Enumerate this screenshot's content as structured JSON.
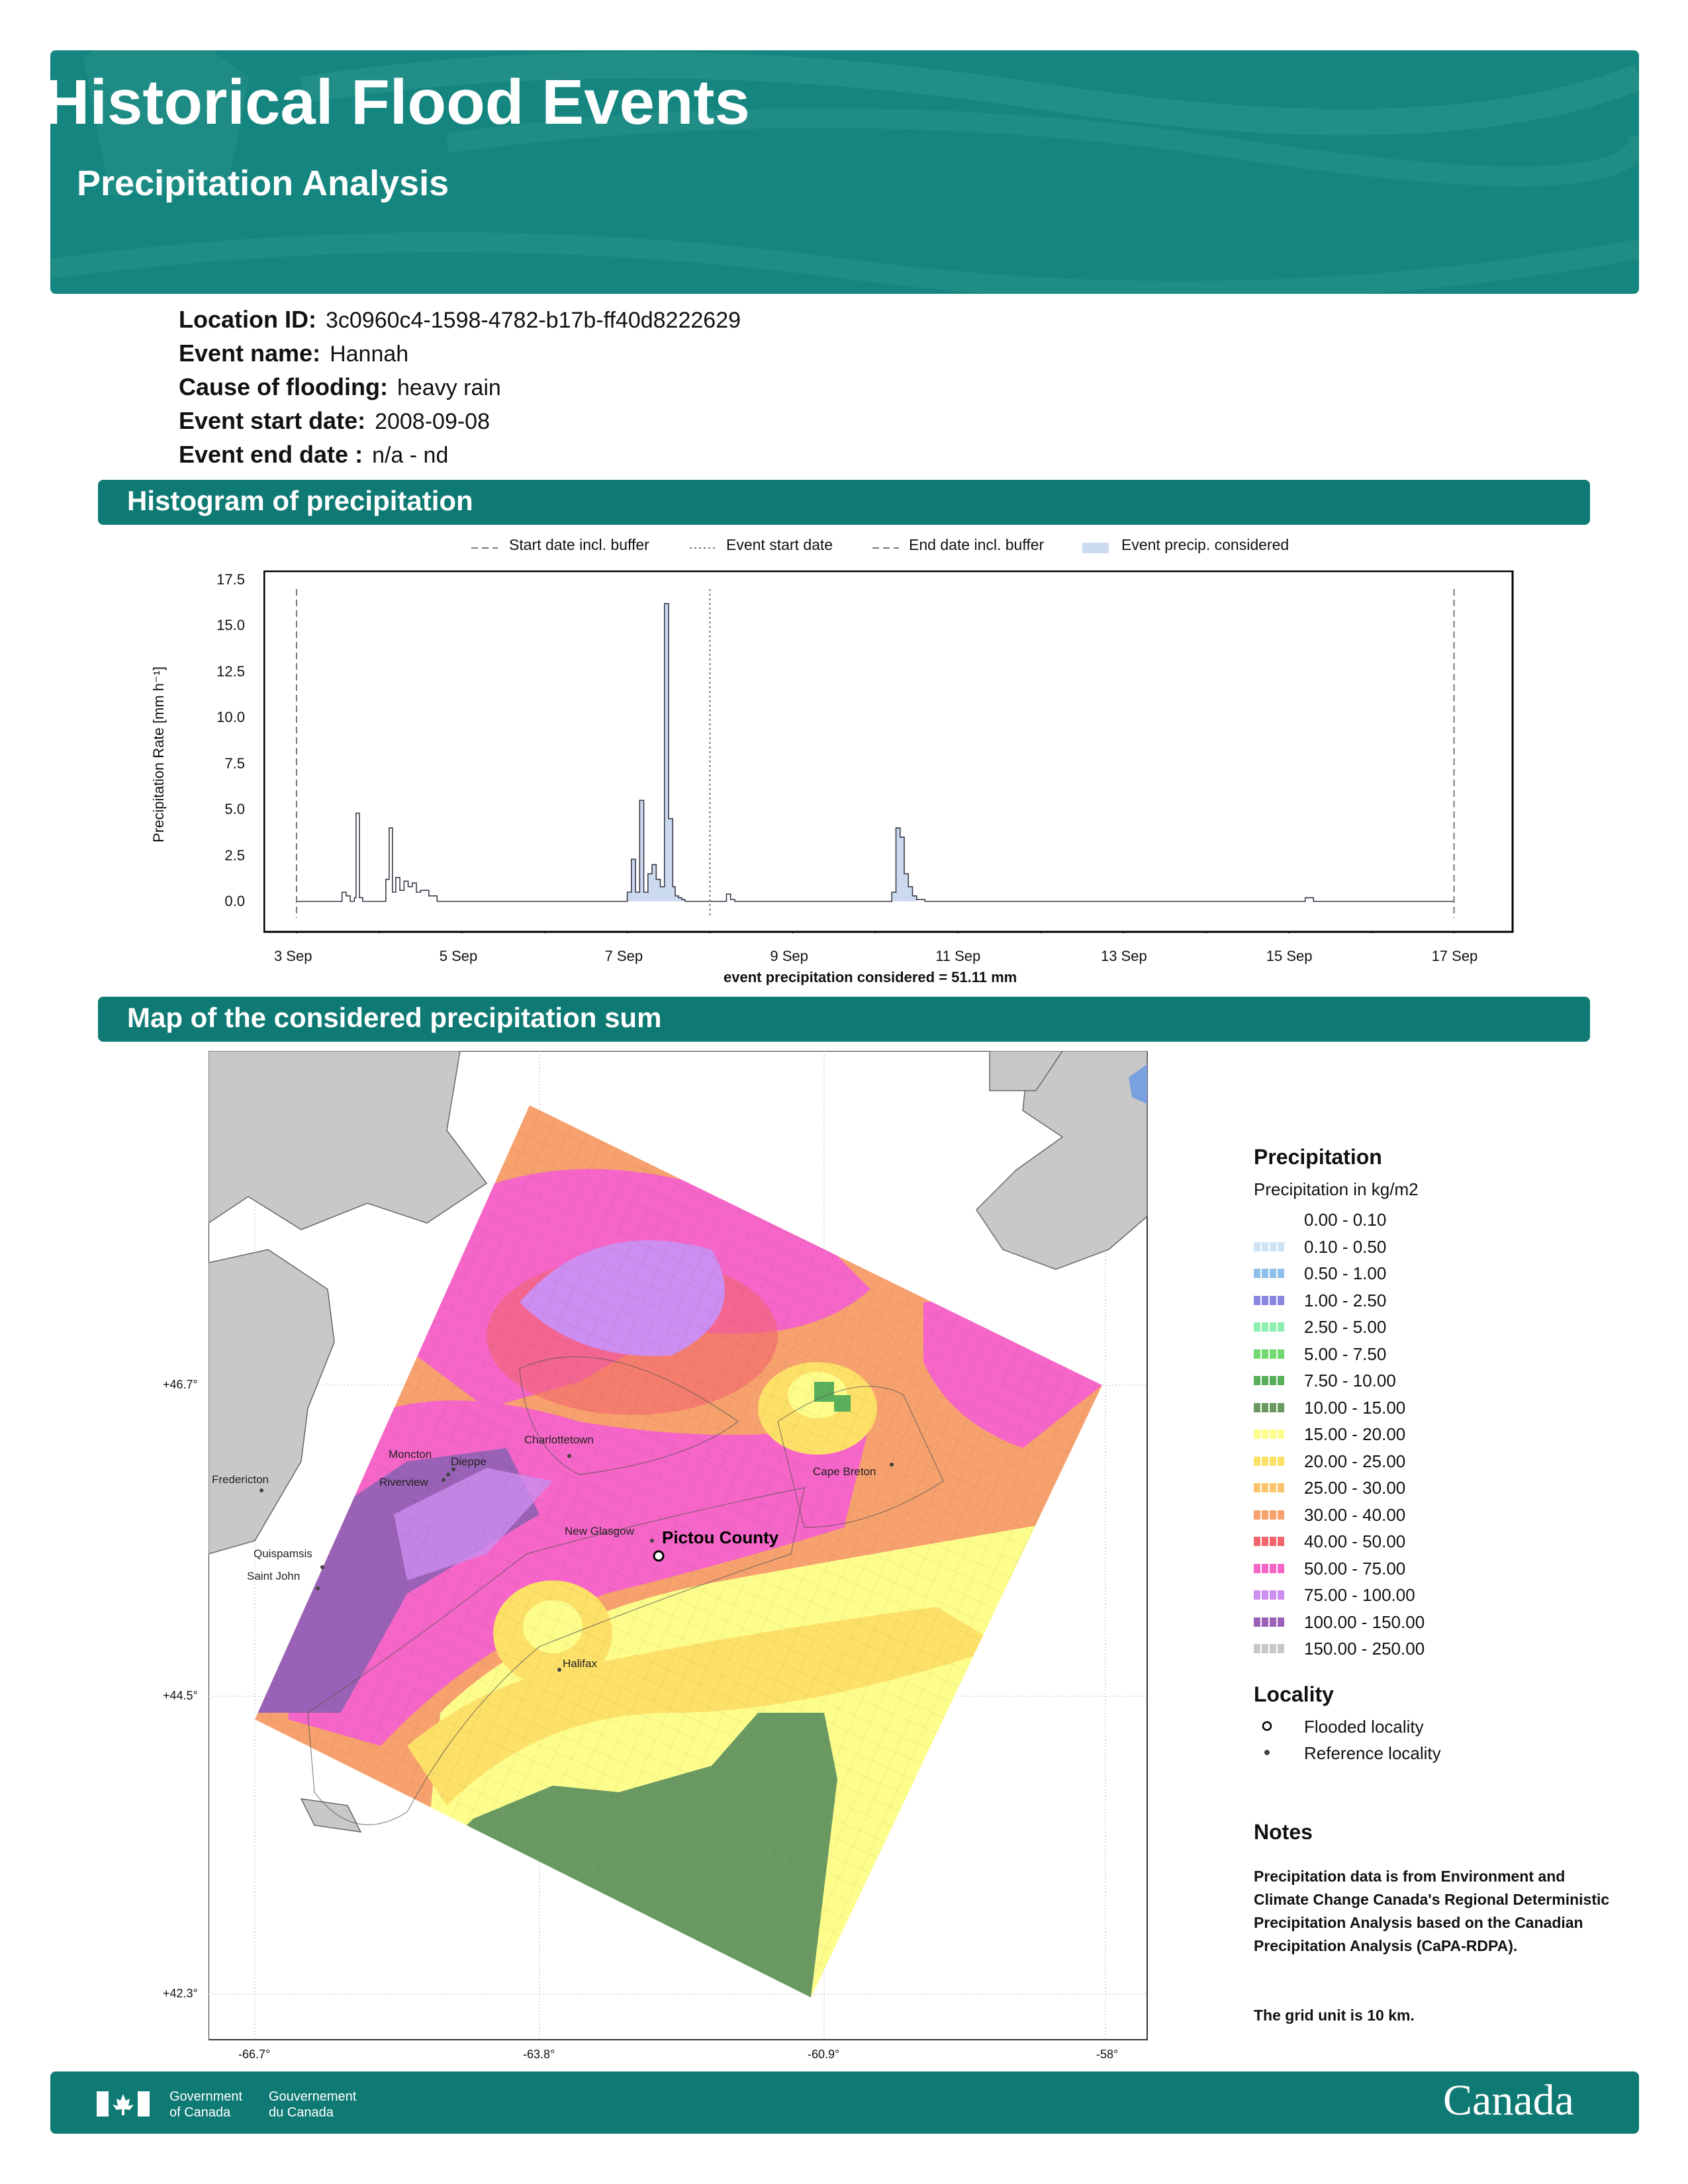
{
  "header": {
    "title": "Historical Flood Events",
    "subtitle": "Precipitation Analysis",
    "colors": {
      "banner": "#15857f",
      "section": "#0f7a74"
    }
  },
  "info": {
    "location_id_label": "Location ID:",
    "location_id": "3c0960c4-1598-4782-b17b-ff40d8222629",
    "event_name_label": "Event name:",
    "event_name": "Hannah",
    "cause_label": "Cause of flooding:",
    "cause": "heavy rain",
    "start_label": "Event start date:",
    "start": "2008-09-08",
    "end_label": "Event end date :",
    "end": "n/a - nd"
  },
  "sections": {
    "histogram": "Histogram of precipitation",
    "map": "Map of the considered precipitation sum"
  },
  "chart_data": {
    "type": "line",
    "ylabel": "Precipitation Rate [mm h⁻¹]",
    "xlabel": "event precipitation considered = 51.11 mm",
    "ylim": [
      0,
      17.5
    ],
    "yticks": [
      "0.0",
      "2.5",
      "5.0",
      "7.5",
      "10.0",
      "12.5",
      "15.0",
      "17.5"
    ],
    "xticks": [
      "3 Sep",
      "5 Sep",
      "7 Sep",
      "9 Sep",
      "11 Sep",
      "13 Sep",
      "15 Sep",
      "17 Sep"
    ],
    "xlim_days": [
      2.6,
      17.7
    ],
    "legend": [
      "Start date incl. buffer",
      "Event start date",
      "End date incl. buffer",
      "Event precip. considered"
    ],
    "legend_position": "top",
    "start_buffer_day": 3.0,
    "event_start_day": 8.0,
    "end_buffer_day": 17.0,
    "considered_range_days": [
      7.0,
      8.0
    ],
    "considered_range_days_b": [
      10.2,
      10.5
    ],
    "series": [
      {
        "x": [
          3.0,
          3.5,
          3.55,
          3.6,
          3.65,
          3.7,
          3.72,
          3.76,
          3.8,
          4.0,
          4.08,
          4.12,
          4.16,
          4.2,
          4.25,
          4.3,
          4.35,
          4.4,
          4.45,
          4.5,
          4.6,
          4.7,
          5.0,
          6.9,
          7.0,
          7.05,
          7.1,
          7.15,
          7.2,
          7.25,
          7.3,
          7.35,
          7.4,
          7.45,
          7.5,
          7.55,
          7.58,
          7.62,
          7.66,
          7.7,
          7.75,
          7.9,
          8.2,
          8.25,
          8.3,
          9.0,
          10.0,
          10.2,
          10.25,
          10.3,
          10.35,
          10.4,
          10.45,
          10.5,
          10.6,
          11.0,
          14.5,
          15.2,
          15.3,
          17.0
        ],
        "y": [
          0.0,
          0.0,
          0.5,
          0.3,
          0.0,
          0.2,
          4.8,
          0.2,
          0.0,
          0.0,
          1.2,
          4.0,
          0.5,
          1.3,
          0.6,
          1.1,
          0.8,
          1.0,
          0.5,
          0.6,
          0.3,
          0.0,
          0.0,
          0.0,
          0.5,
          2.3,
          0.5,
          5.5,
          0.5,
          1.5,
          2.0,
          1.2,
          0.8,
          16.2,
          4.5,
          0.8,
          0.3,
          0.2,
          0.1,
          0.0,
          0.0,
          0.0,
          0.4,
          0.1,
          0.0,
          0.0,
          0.0,
          0.5,
          4.0,
          3.5,
          1.5,
          0.8,
          0.3,
          0.1,
          0.0,
          0.0,
          0.0,
          0.2,
          0.0,
          0.0
        ]
      }
    ]
  },
  "map": {
    "lon_ticks": [
      "-66.7°",
      "-63.8°",
      "-60.9°",
      "-58°"
    ],
    "lat_ticks": [
      "+46.7°",
      "+44.5°",
      "+42.3°"
    ],
    "places": {
      "flooded": "Pictou County",
      "reference": [
        "Charlottetown",
        "Moncton",
        "Dieppe",
        "Riverview",
        "Fredericton",
        "Cape Breton",
        "New Glasgow",
        "Quispamsis",
        "Saint John",
        "Halifax"
      ]
    }
  },
  "map_legend": {
    "precip_title": "Precipitation",
    "precip_subtitle": "Precipitation in kg/m2",
    "classes": [
      {
        "label": "0.00 - 0.10",
        "color": "#ffffff"
      },
      {
        "label": "0.10 - 0.50",
        "color": "#cfe3f5"
      },
      {
        "label": "0.50 - 1.00",
        "color": "#8fc0ec"
      },
      {
        "label": "1.00 - 2.50",
        "color": "#8a86e0"
      },
      {
        "label": "2.50 - 5.00",
        "color": "#8ef0b0"
      },
      {
        "label": "5.00 - 7.50",
        "color": "#72d872"
      },
      {
        "label": "7.50 - 10.00",
        "color": "#5ab05a"
      },
      {
        "label": "10.00 - 15.00",
        "color": "#6a9a62"
      },
      {
        "label": "15.00 - 20.00",
        "color": "#fdfd8c"
      },
      {
        "label": "20.00 - 25.00",
        "color": "#fde068"
      },
      {
        "label": "25.00 - 30.00",
        "color": "#fcc46e"
      },
      {
        "label": "30.00 - 40.00",
        "color": "#f7a16e"
      },
      {
        "label": "40.00 - 50.00",
        "color": "#f2666e"
      },
      {
        "label": "50.00 - 75.00",
        "color": "#f566c8"
      },
      {
        "label": "75.00 - 100.00",
        "color": "#cc8ef0"
      },
      {
        "label": "100.00 - 150.00",
        "color": "#9a62b6"
      },
      {
        "label": "150.00 - 250.00",
        "color": "#c8c8c8"
      }
    ],
    "locality_title": "Locality",
    "flooded_label": "Flooded locality",
    "reference_label": "Reference locality",
    "notes_title": "Notes",
    "notes_text": "Precipitation data is from Environment and Climate Change Canada's Regional Deterministic Precipitation Analysis based on the Canadian Precipitation Analysis (CaPA-RDPA).",
    "notes_grid": "The grid unit is 10 km."
  },
  "footer": {
    "gov_en_1": "Government",
    "gov_en_2": "of Canada",
    "gov_fr_1": "Gouvernement",
    "gov_fr_2": "du Canada",
    "wordmark": "Canada"
  }
}
